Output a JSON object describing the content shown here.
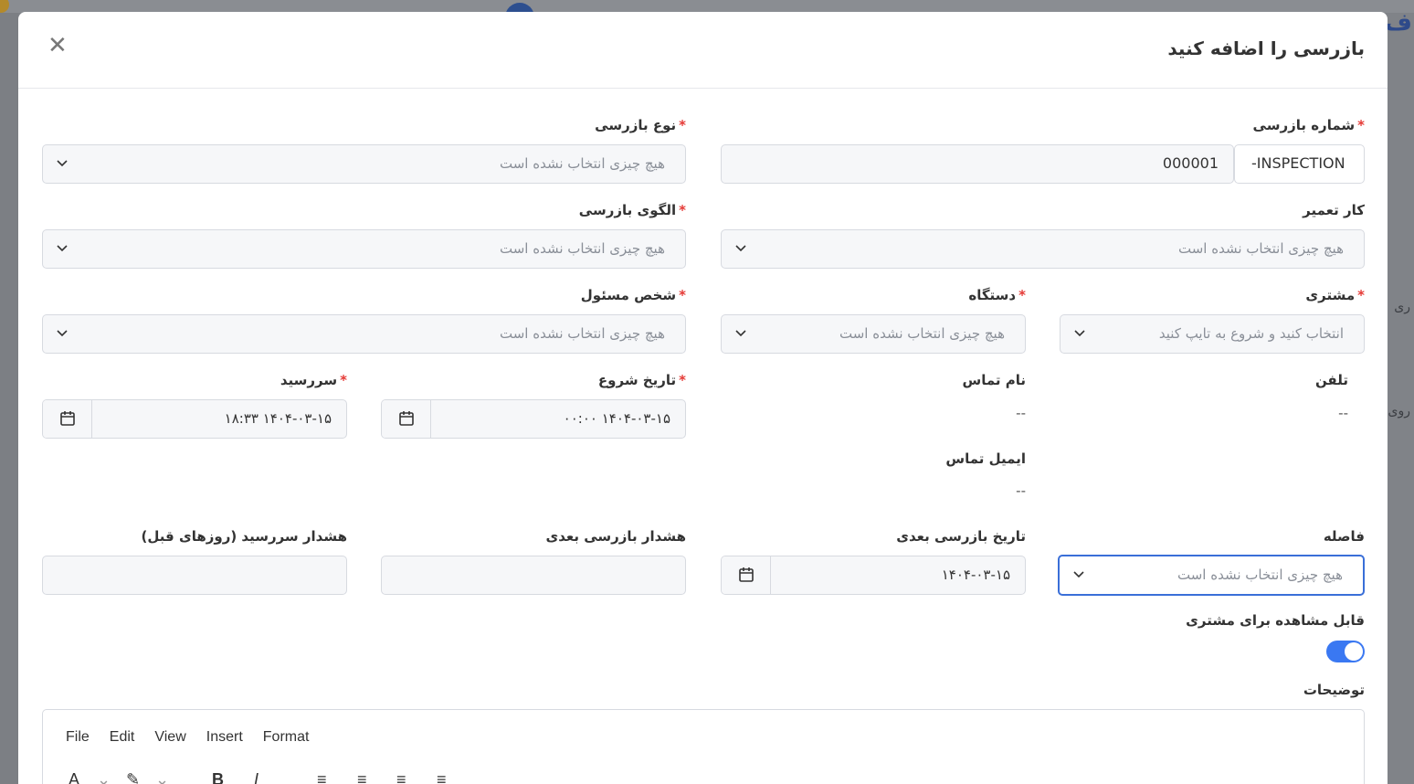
{
  "modal": {
    "title": "بازرسی را اضافه کنید",
    "close_label": "✕"
  },
  "fields": {
    "inspection_number": {
      "label": "شماره بازرسی",
      "prefix": "INSPECTION-",
      "value": "000001"
    },
    "inspection_type": {
      "label": "نوع بازرسی",
      "placeholder": "هیچ چیزی انتخاب نشده است"
    },
    "repair_job": {
      "label": "کار تعمیر",
      "placeholder": "هیچ چیزی انتخاب نشده است"
    },
    "inspection_template": {
      "label": "الگوی بازرسی",
      "placeholder": "هیچ چیزی انتخاب نشده است"
    },
    "customer": {
      "label": "مشتری",
      "placeholder": "انتخاب کنید و شروع به تایپ کنید"
    },
    "device": {
      "label": "دستگاه",
      "placeholder": "هیچ چیزی انتخاب نشده است"
    },
    "responsible_person": {
      "label": "شخص مسئول",
      "placeholder": "هیچ چیزی انتخاب نشده است"
    },
    "phone": {
      "label": "تلفن",
      "value": "--"
    },
    "contact_name": {
      "label": "نام تماس",
      "value": "--"
    },
    "contact_email": {
      "label": "ایمیل تماس",
      "value": "--"
    },
    "start_date": {
      "label": "تاریخ شروع",
      "value": "۱۴۰۴-۰۳-۱۵ ۰۰:۰۰"
    },
    "due_date": {
      "label": "سررسید",
      "value": "۱۴۰۴-۰۳-۱۵ ۱۸:۳۳"
    },
    "interval": {
      "label": "فاصله",
      "placeholder": "هیچ چیزی انتخاب نشده است"
    },
    "next_inspection_date": {
      "label": "تاریخ بازرسی بعدی",
      "value": "۱۴۰۴-۰۳-۱۵"
    },
    "next_inspection_alert": {
      "label": "هشدار بازرسی بعدی",
      "value": ""
    },
    "due_alert": {
      "label": "هشدار سررسید (روزهای قبل)",
      "value": ""
    },
    "visible_to_customer": {
      "label": "قابل مشاهده برای مشتری",
      "enabled": true
    },
    "description": {
      "label": "توضیحات"
    }
  },
  "required_mark": "*",
  "editor": {
    "menus": [
      "File",
      "Edit",
      "View",
      "Insert",
      "Format"
    ],
    "tools": [
      "A",
      "⌄",
      "✎",
      "⌄",
      "B",
      "I",
      "≡",
      "≡",
      "≡",
      "≡"
    ]
  },
  "background": {
    "right_text_1": "ری",
    "right_text_2": "روی",
    "right_text_top": "ف"
  },
  "colors": {
    "accent": "#3a78f2",
    "required": "#e53935",
    "focus_border": "#3a6fd8"
  }
}
